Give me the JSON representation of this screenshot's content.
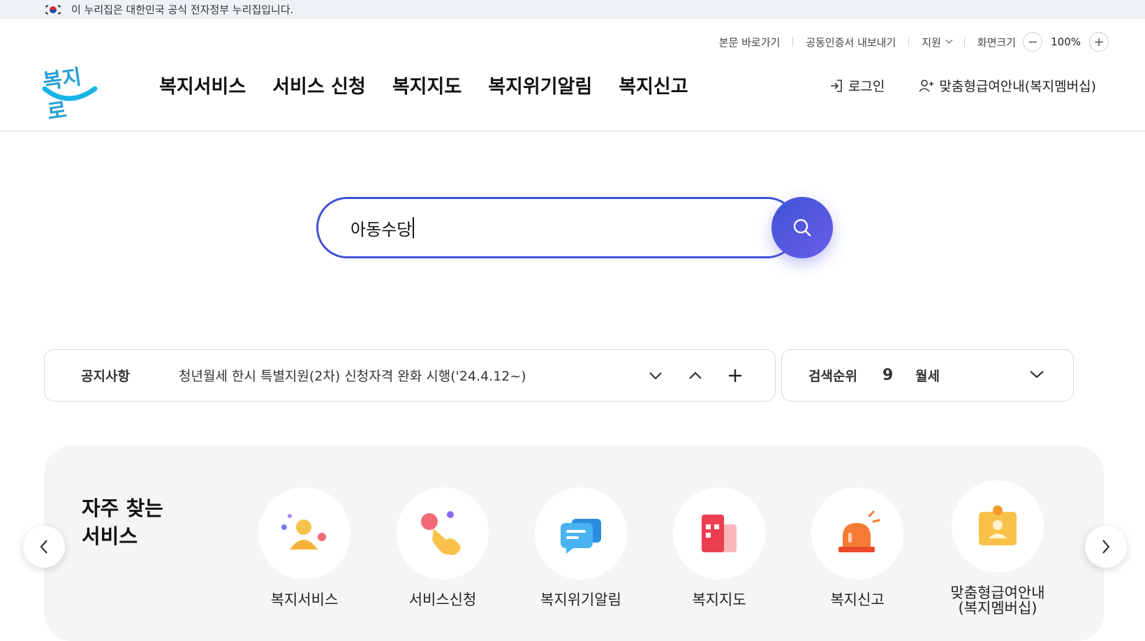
{
  "gov_banner": {
    "text": "이 누리집은 대한민국 공식 전자정부 누리집입니다."
  },
  "util": {
    "skip": "본문 바로가기",
    "cert": "공동인증서 내보내기",
    "support": "지원",
    "zoom_label": "화면크기",
    "zoom_minus": "−",
    "zoom_value": "100%",
    "zoom_plus": "+"
  },
  "logo": {
    "text": "복지로"
  },
  "gnb": [
    "복지서비스",
    "서비스 신청",
    "복지지도",
    "복지위기알림",
    "복지신고"
  ],
  "account": {
    "login": "로그인",
    "membership": "맞춤형급여안내(복지멤버십)"
  },
  "search": {
    "value": "아동수당"
  },
  "notice": {
    "label": "공지사항",
    "message": "청년월세 한시 특별지원(2차) 신청자격 완화 시행('24.4.12~)"
  },
  "rank": {
    "label": "검색순위",
    "number": "9",
    "keyword": "월세"
  },
  "frequent": {
    "title_line1": "자주 찾는",
    "title_line2": "서비스",
    "services": [
      {
        "name": "복지서비스",
        "icon": "person-icon"
      },
      {
        "name": "서비스신청",
        "icon": "hand-tap-icon"
      },
      {
        "name": "복지위기알림",
        "icon": "chat-bubble-icon"
      },
      {
        "name": "복지지도",
        "icon": "map-icon"
      },
      {
        "name": "복지신고",
        "icon": "siren-icon"
      },
      {
        "name": "맞춤형급여안내",
        "name2": "(복지멤버십)",
        "icon": "member-card-icon"
      }
    ]
  },
  "colors": {
    "accent": "#3f51d6",
    "logo": "#2a9fd6",
    "panel": "#f5f5f5"
  }
}
